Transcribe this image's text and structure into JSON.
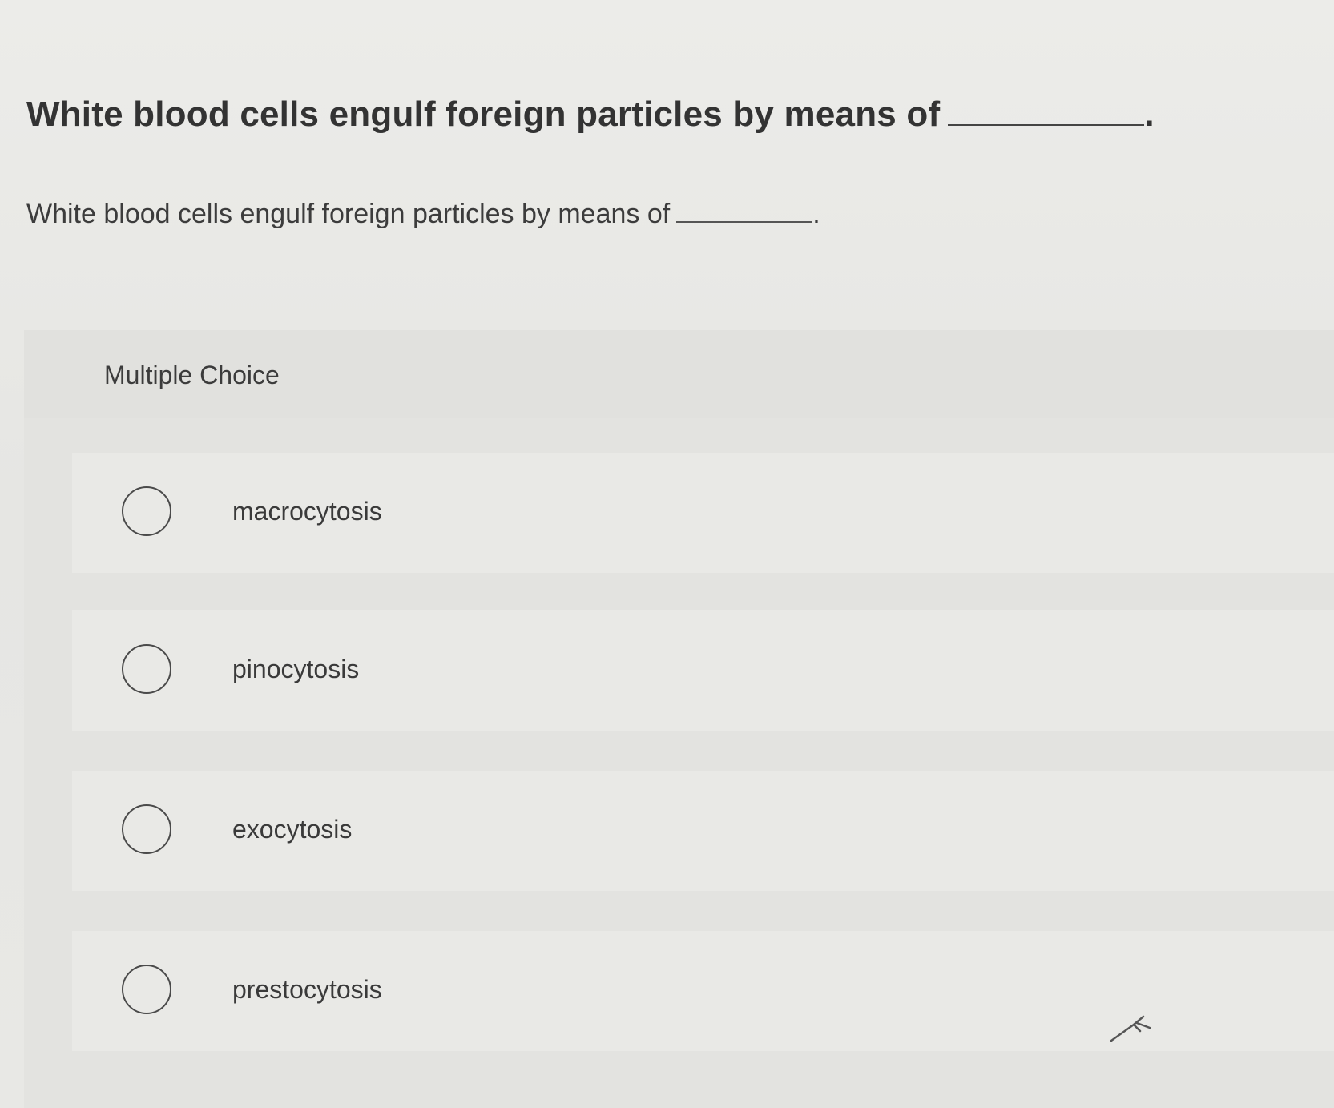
{
  "question": {
    "title": "White blood cells engulf foreign particles by means of",
    "title_suffix": ".",
    "text": "White blood cells engulf foreign particles by means of",
    "text_suffix": "."
  },
  "multiple_choice": {
    "label": "Multiple Choice",
    "options": [
      {
        "label": "macrocytosis",
        "selected": false
      },
      {
        "label": "pinocytosis",
        "selected": false
      },
      {
        "label": "exocytosis",
        "selected": false
      },
      {
        "label": "prestocytosis",
        "selected": false
      }
    ]
  },
  "colors": {
    "background": "#e7e7e4",
    "text": "#3a3a3a",
    "radio_border": "#4a4a4a"
  }
}
